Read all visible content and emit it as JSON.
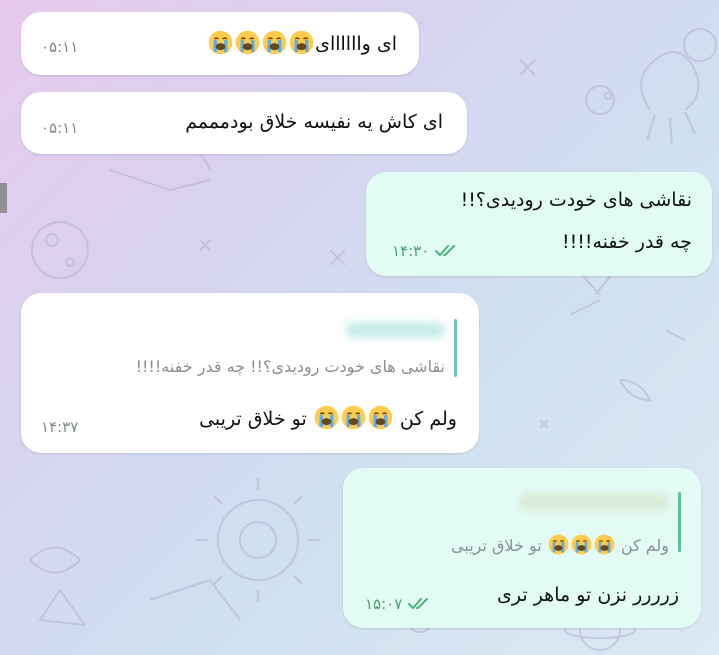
{
  "chat": {
    "messages": [
      {
        "direction": "incoming",
        "text": "ای واااااای",
        "emoji_count": 4,
        "emoji": "loudly-crying-face",
        "time": "۰۵:۱۱"
      },
      {
        "direction": "incoming",
        "text": "ای کاش یه نفیسه خلاق بودمممم",
        "time": "۰۵:۱۱"
      },
      {
        "direction": "outgoing",
        "lines": [
          "نقاشی های خودت رودیدی؟!!",
          "چه قدر خفنه!!!!"
        ],
        "time": "۱۴:۳۰",
        "status": "read"
      },
      {
        "direction": "incoming",
        "reply_text": "نقاشی های خودت رودیدی؟!! چه قدر خفنه!!!!",
        "text_start": "ولم کن",
        "emoji_count": 3,
        "emoji": "loudly-crying-face",
        "text_end": "تو خلاق تریبی",
        "time": "۱۴:۳۷"
      },
      {
        "direction": "outgoing",
        "reply_text_start": "ولم کن",
        "reply_emoji_count": 3,
        "reply_text_end": "تو خلاق تریبی",
        "text": "زرررر نزن تو ماهر تری",
        "time": "۱۵:۰۷",
        "status": "read"
      }
    ]
  },
  "colors": {
    "incoming_bubble": "#ffffff",
    "outgoing_bubble": "#e2fbf4",
    "reply_bar_incoming": "#6cc4c1",
    "reply_bar_outgoing": "#5cbf9a",
    "read_check": "#4fb17e"
  }
}
